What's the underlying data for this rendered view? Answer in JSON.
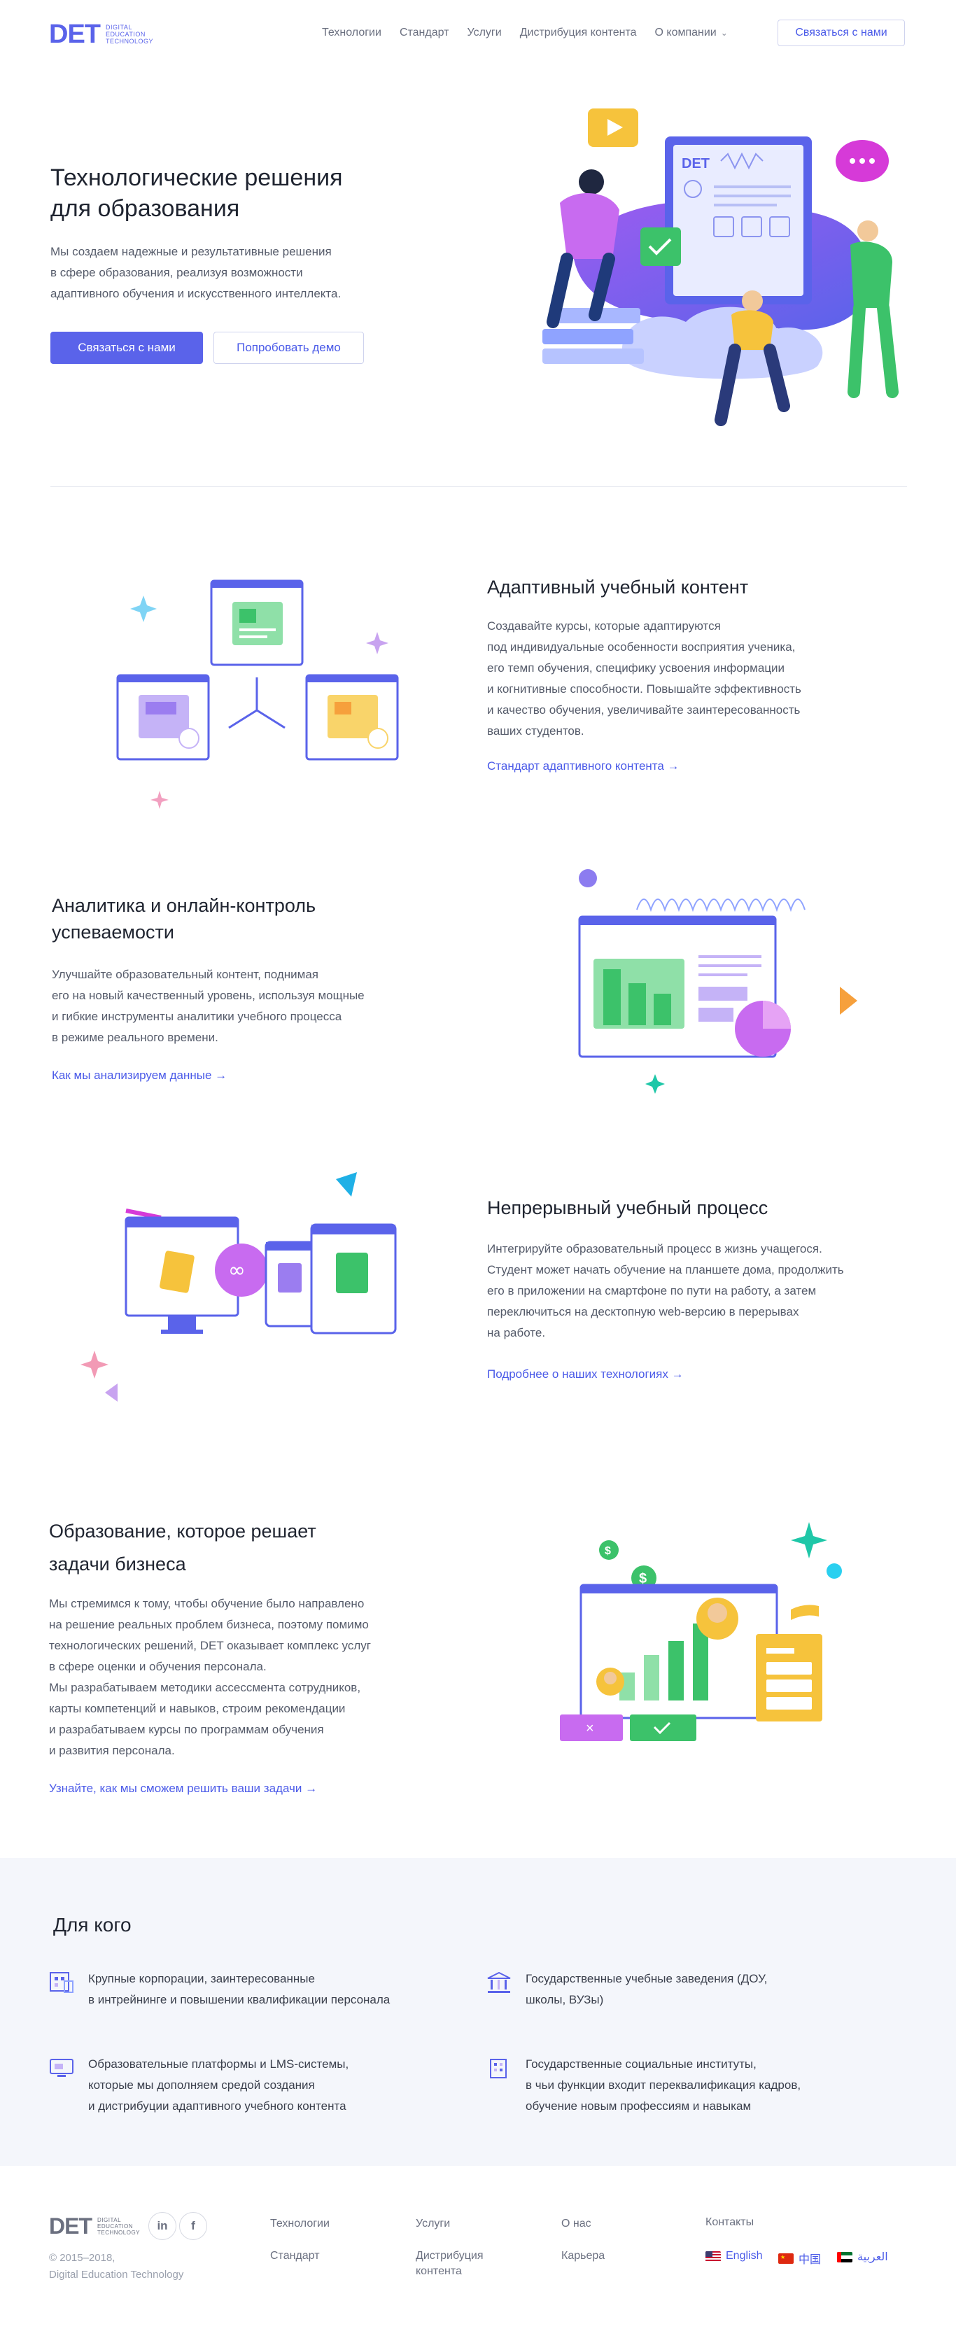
{
  "brand": {
    "mark": "DET",
    "sub_line1": "Digital",
    "sub_line2": "Education",
    "sub_line3": "Technology",
    "accent": "#5a63ea"
  },
  "nav": {
    "items": [
      "Технологии",
      "Стандарт",
      "Услуги",
      "Дистрибуция контента",
      "О компании"
    ],
    "contact_button": "Связаться с нами"
  },
  "hero": {
    "title": "Технологические решения\nдля образования",
    "text": "Мы создаем надежные и результативные решения\nв сфере образования, реализуя возможности\nадаптивного обучения и искусственного интеллекта.",
    "primary_button": "Связаться с нами",
    "secondary_button": "Попробовать демо",
    "illus_logo": "DET"
  },
  "features": [
    {
      "title": "Адаптивный учебный контент",
      "text": "Создавайте курсы, которые адаптируются\nпод индивидуальные особенности восприятия ученика,\nего темп обучения, специфику усвоения информации\nи когнитивные способности. Повышайте эффективность\nи качество обучения, увеличивайте заинтересованность\nваших студентов.",
      "link": "Стандарт адаптивного контента →"
    },
    {
      "title": "Аналитика и онлайн-контроль\nуспеваемости",
      "text": "Улучшайте образовательный контент, поднимая\nего на новый качественный уровень, используя мощные\nи гибкие инструменты аналитики учебного процесса\nв режиме реального времени.",
      "link": "Как мы анализируем данные →"
    },
    {
      "title": "Непрерывный учебный процесс",
      "text": "Интегрируйте образовательный процесс в жизнь учащегося.\nСтудент может начать обучение на планшете дома, продолжить\nего в приложении на смартфоне по пути на работу, а затем\nпереключиться на десктопную web-версию в перерывах\nна работе.",
      "link": "Подробнее о наших технологиях →"
    },
    {
      "title": "Образование, которое решает\nзадачи бизнеса",
      "text": "Мы стремимся к тому, чтобы обучение было направлено\nна решение реальных проблем бизнеса, поэтому помимо\nтехнологических решений, DET оказывает комплекс услуг\nв сфере оценки и обучения персонала.\nМы разрабатываем методики ассессмента сотрудников,\nкарты компетенций и навыков, строим рекомендации\nи разрабатываем курсы по программам обучения\nи развития персонала.",
      "link": "Узнайте, как мы сможем решить ваши задачи →"
    }
  ],
  "for_whom": {
    "title": "Для кого",
    "items": [
      {
        "icon": "corporation-icon",
        "text": "Крупные корпорации, заинтересованные\nв интрейнинге и повышении квалификации персонала"
      },
      {
        "icon": "state-institution-icon",
        "text": "Государственные учебные заведения (ДОУ,\nшколы, ВУЗы)"
      },
      {
        "icon": "platform-icon",
        "text": "Образовательные платформы и LMS-системы,\nкоторые мы дополняем средой создания\nи дистрибуции адаптивного учебного контента"
      },
      {
        "icon": "social-institute-icon",
        "text": "Государственные социальные институты,\nв чьи функции входит переквалификация кадров,\nобучение новым профессиям и навыкам"
      }
    ]
  },
  "footer": {
    "social": [
      "in",
      "f"
    ],
    "copyright": "© 2015–2018,\nDigital Education Technology",
    "col1": [
      "Технологии",
      "Стандарт"
    ],
    "col2": [
      "Услуги",
      "Дистрибуция\nконтента"
    ],
    "col3": [
      "О нас",
      "Карьера"
    ],
    "contacts": "Контакты",
    "languages": [
      "English",
      "中国",
      "العربية"
    ]
  }
}
